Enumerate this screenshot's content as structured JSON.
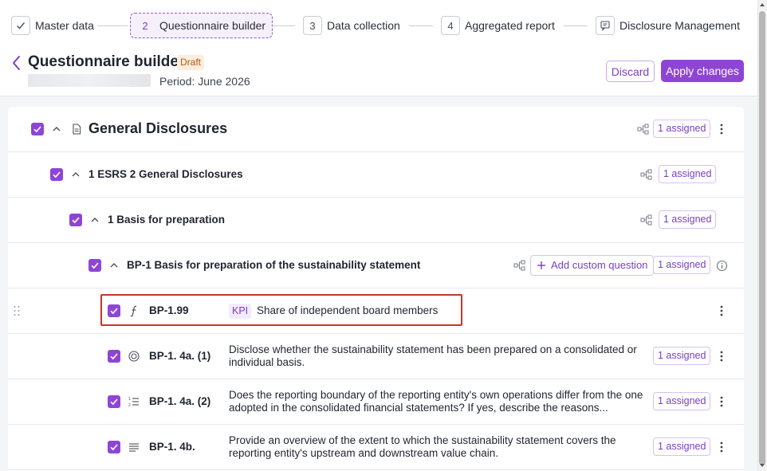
{
  "stepper": {
    "steps": [
      {
        "num": "",
        "label": "Master data",
        "state": "done"
      },
      {
        "num": "2",
        "label": "Questionnaire builder",
        "state": "active"
      },
      {
        "num": "3",
        "label": "Data collection",
        "state": "pending"
      },
      {
        "num": "4",
        "label": "Aggregated report",
        "state": "pending"
      },
      {
        "num": "",
        "label": "Disclosure Management",
        "state": "pending"
      }
    ]
  },
  "header": {
    "title": "Questionnaire builder",
    "status_badge": "Draft",
    "period": "Period: June 2026",
    "discard_label": "Discard",
    "apply_label": "Apply changes"
  },
  "tree": {
    "sections": [
      {
        "label": "General Disclosures",
        "assigned": "1 assigned"
      },
      {
        "label": "1 ESRS 2 General Disclosures",
        "assigned": "1 assigned"
      },
      {
        "label": "1 Basis for preparation",
        "assigned": "1 assigned"
      },
      {
        "label": "BP-1 Basis for preparation of the sustainability statement",
        "assigned": "1 assigned",
        "add_custom": "Add custom question"
      }
    ],
    "questions": [
      {
        "code": "BP-1.99",
        "tag": "KPI",
        "text": "Share of independent board members",
        "icon": "formula-icon",
        "assigned": ""
      },
      {
        "code": "BP-1. 4a. (1)",
        "text": "Disclose whether the sustainability statement has been prepared on a consolidated or individual basis.",
        "icon": "radio-icon",
        "assigned": "1 assigned"
      },
      {
        "code": "BP-1. 4a. (2)",
        "text": "Does the reporting boundary of the reporting entity's own operations differ from the one adopted in the consolidated financial statements? If yes, describe the reasons...",
        "icon": "list-icon",
        "assigned": "1 assigned"
      },
      {
        "code": "BP-1. 4b.",
        "text": "Provide an overview of the extent to which the sustainability statement covers the reporting entity's upstream and downstream value chain.",
        "icon": "text-icon",
        "assigned": "1 assigned"
      }
    ]
  },
  "colors": {
    "accent": "#8e45d6",
    "highlight": "#c0392b"
  }
}
